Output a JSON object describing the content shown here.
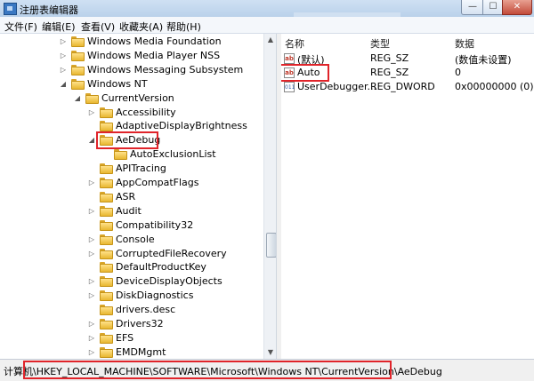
{
  "window": {
    "title": "注册表编辑器",
    "buttons": {
      "minimize": "—",
      "maximize": "☐",
      "close": "✕"
    }
  },
  "menu": [
    "文件(F)",
    "编辑(E)",
    "查看(V)",
    "收藏夹(A)",
    "帮助(H)"
  ],
  "tree": {
    "items": [
      {
        "label": "Windows Media Foundation",
        "expander": "▷"
      },
      {
        "label": "Windows Media Player NSS",
        "expander": "▷"
      },
      {
        "label": "Windows Messaging Subsystem",
        "expander": "▷"
      },
      {
        "label": "Windows NT",
        "expander": "◢"
      },
      {
        "label": "CurrentVersion",
        "expander": "◢"
      },
      {
        "label": "Accessibility",
        "expander": "▷"
      },
      {
        "label": "AdaptiveDisplayBrightness",
        "expander": ""
      },
      {
        "label": "AeDebug",
        "expander": "◢"
      },
      {
        "label": "AutoExclusionList",
        "expander": ""
      },
      {
        "label": "APITracing",
        "expander": ""
      },
      {
        "label": "AppCompatFlags",
        "expander": "▷"
      },
      {
        "label": "ASR",
        "expander": ""
      },
      {
        "label": "Audit",
        "expander": "▷"
      },
      {
        "label": "Compatibility32",
        "expander": ""
      },
      {
        "label": "Console",
        "expander": "▷"
      },
      {
        "label": "CorruptedFileRecovery",
        "expander": "▷"
      },
      {
        "label": "DefaultProductKey",
        "expander": ""
      },
      {
        "label": "DeviceDisplayObjects",
        "expander": "▷"
      },
      {
        "label": "DiskDiagnostics",
        "expander": "▷"
      },
      {
        "label": "drivers.desc",
        "expander": ""
      },
      {
        "label": "Drivers32",
        "expander": "▷"
      },
      {
        "label": "EFS",
        "expander": "▷"
      },
      {
        "label": "EMDMgmt",
        "expander": "▷"
      }
    ]
  },
  "values_pane": {
    "headers": {
      "name": "名称",
      "type": "类型",
      "data": "数据"
    },
    "rows": [
      {
        "icon": "ab",
        "name": "(默认)",
        "type": "REG_SZ",
        "data": "(数值未设置)"
      },
      {
        "icon": "ab",
        "name": "Auto",
        "type": "REG_SZ",
        "data": "0"
      },
      {
        "icon": "011",
        "name": "UserDebugger...",
        "type": "REG_DWORD",
        "data": "0x00000000 (0)"
      }
    ]
  },
  "status": {
    "path": "计算机\\HKEY_LOCAL_MACHINE\\SOFTWARE\\Microsoft\\Windows NT\\CurrentVersion\\AeDebug"
  },
  "scrollbar": {
    "up": "▲",
    "down": "▼"
  },
  "colors": {
    "highlight": "#e0242a",
    "folder": "#e8b730",
    "titlebar": "#b9d1ea"
  }
}
